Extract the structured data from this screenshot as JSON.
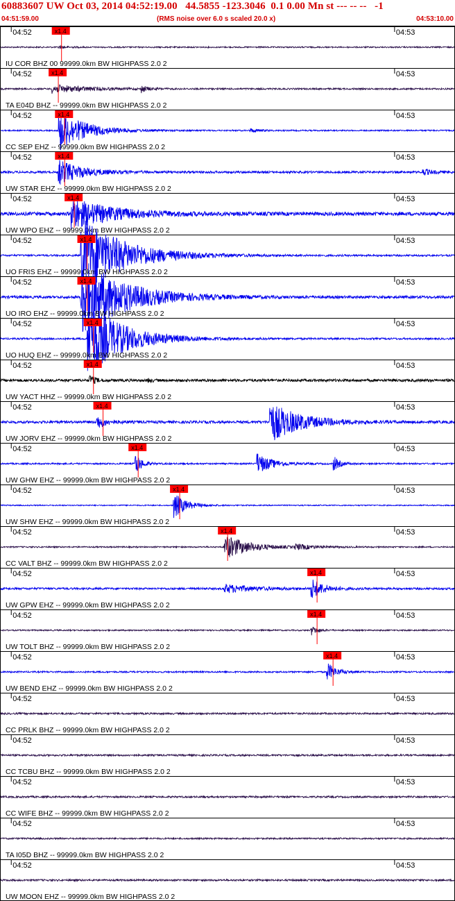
{
  "header": {
    "title": "60883607 UW Oct 03, 2014 04:52:19.00   44.5855 -123.3046  0.1 0.00 Mn st --- -- --   -1",
    "start_time": "04:51:59.00",
    "note": "(RMS noise over 6.0 s scaled 20.0 x)",
    "end_time": "04:53:10.00"
  },
  "colors": {
    "title": "#d40000",
    "trace_blue": "#0000ee",
    "trace_dark": "#2a0f4a",
    "trace_black": "#000000",
    "pick_box": "#ff0000",
    "pick_line": "#ff0000",
    "grid": "#000000"
  },
  "chart_data": {
    "type": "seismogram",
    "x_range_seconds": [
      0,
      71
    ],
    "time_ticks": [
      {
        "label": "04:52",
        "t": 1
      },
      {
        "label": "04:53",
        "t": 61
      }
    ],
    "pick_label": "x1.4",
    "traces": [
      {
        "label": "IU COR BHZ 00 99999.0km BW  HIGHPASS  2.0  2",
        "pick_t": 8.0,
        "color": "dark",
        "noise": 0.6,
        "events": [
          {
            "t": 9,
            "amp": 2,
            "dur": 3
          }
        ]
      },
      {
        "label": "TA E04D BHZ -- 99999.0km BW  HIGHPASS  2.0  2",
        "pick_t": 7.5,
        "color": "dark",
        "noise": 0.7,
        "events": [
          {
            "t": 8,
            "amp": 6,
            "dur": 12
          },
          {
            "t": 22,
            "amp": 5,
            "dur": 2
          }
        ]
      },
      {
        "label": "CC SEP EHZ -- 99999.0km BW  HIGHPASS  2.0  2",
        "pick_t": 8.5,
        "color": "blue",
        "noise": 0.6,
        "events": [
          {
            "t": 9,
            "amp": 30,
            "dur": 9
          },
          {
            "t": 39,
            "amp": 3,
            "dur": 3
          }
        ]
      },
      {
        "label": "UW STAR EHZ -- 99999.0km BW  HIGHPASS  2.0  2",
        "pick_t": 8.5,
        "color": "blue",
        "noise": 1.0,
        "events": [
          {
            "t": 9,
            "amp": 18,
            "dur": 8
          },
          {
            "t": 66,
            "amp": 4,
            "dur": 4
          }
        ]
      },
      {
        "label": "UW WPO EHZ -- 99999.0km BW  HIGHPASS  2.0  2",
        "pick_t": 10.0,
        "color": "blue",
        "noise": 1.6,
        "events": [
          {
            "t": 11,
            "amp": 22,
            "dur": 14
          }
        ]
      },
      {
        "label": "UO FRIS EHZ -- 99999.0km BW  HIGHPASS  2.0  2",
        "pick_t": 12.0,
        "color": "blue",
        "noise": 0.8,
        "events": [
          {
            "t": 12.5,
            "amp": 60,
            "dur": 14
          }
        ]
      },
      {
        "label": "UO IRO EHZ -- 99999.0km BW  HIGHPASS  2.0  2",
        "pick_t": 12.0,
        "color": "blue",
        "noise": 1.2,
        "events": [
          {
            "t": 12.5,
            "amp": 60,
            "dur": 14
          }
        ]
      },
      {
        "label": "UO HUQ EHZ -- 99999.0km BW  HIGHPASS  2.0  2",
        "pick_t": 13.0,
        "color": "blue",
        "noise": 0.8,
        "events": [
          {
            "t": 13.5,
            "amp": 55,
            "dur": 12
          }
        ]
      },
      {
        "label": "UW YACT HHZ -- 99999.0km BW  HIGHPASS  2.0  2",
        "pick_t": 13.0,
        "color": "black",
        "noise": 1.2,
        "events": [
          {
            "t": 13.8,
            "amp": 8,
            "dur": 2
          },
          {
            "t": 23,
            "amp": 4,
            "dur": 1
          }
        ]
      },
      {
        "label": "UW JORV EHZ -- 99999.0km BW  HIGHPASS  2.0  2",
        "pick_t": 14.5,
        "color": "blue",
        "noise": 1.2,
        "events": [
          {
            "t": 15,
            "amp": 10,
            "dur": 3
          },
          {
            "t": 42,
            "amp": 30,
            "dur": 10
          }
        ]
      },
      {
        "label": "UW GHW EHZ -- 99999.0km BW  HIGHPASS  2.0  2",
        "pick_t": 20.0,
        "color": "blue",
        "noise": 0.7,
        "events": [
          {
            "t": 21,
            "amp": 18,
            "dur": 2
          },
          {
            "t": 40,
            "amp": 16,
            "dur": 5
          },
          {
            "t": 52,
            "amp": 12,
            "dur": 2
          }
        ]
      },
      {
        "label": "UW SHW EHZ -- 99999.0km BW  HIGHPASS  2.0  2",
        "pick_t": 26.5,
        "color": "blue",
        "noise": 0.5,
        "events": [
          {
            "t": 27,
            "amp": 20,
            "dur": 4
          }
        ]
      },
      {
        "label": "CC VALT BHZ -- 99999.0km BW  HIGHPASS  2.0  2",
        "pick_t": 34.0,
        "color": "dark",
        "noise": 0.6,
        "events": [
          {
            "t": 35,
            "amp": 18,
            "dur": 8
          },
          {
            "t": 46,
            "amp": 4,
            "dur": 6
          }
        ]
      },
      {
        "label": "UW GPW EHZ -- 99999.0km BW  HIGHPASS  2.0  2",
        "pick_t": 48.0,
        "color": "blue",
        "noise": 0.9,
        "events": [
          {
            "t": 35,
            "amp": 6,
            "dur": 10
          },
          {
            "t": 48.5,
            "amp": 16,
            "dur": 4
          }
        ]
      },
      {
        "label": "UW TOLT BHZ -- 99999.0km BW  HIGHPASS  2.0  2",
        "pick_t": 48.0,
        "color": "dark",
        "noise": 0.6,
        "events": [
          {
            "t": 48.5,
            "amp": 8,
            "dur": 2
          }
        ]
      },
      {
        "label": "UW BEND EHZ -- 99999.0km BW  HIGHPASS  2.0  2",
        "pick_t": 50.5,
        "color": "blue",
        "noise": 0.7,
        "events": [
          {
            "t": 51,
            "amp": 14,
            "dur": 3
          }
        ]
      },
      {
        "label": "CC PRLK BHZ -- 99999.0km BW  HIGHPASS  2.0  2",
        "pick_t": null,
        "color": "dark",
        "noise": 0.8,
        "events": []
      },
      {
        "label": "CC TCBU BHZ -- 99999.0km BW  HIGHPASS  2.0  2",
        "pick_t": null,
        "color": "dark",
        "noise": 0.8,
        "events": []
      },
      {
        "label": "CC WIFE BHZ -- 99999.0km BW  HIGHPASS  2.0  2",
        "pick_t": null,
        "color": "dark",
        "noise": 0.8,
        "events": []
      },
      {
        "label": "TA I05D BHZ -- 99999.0km BW  HIGHPASS  2.0  2",
        "pick_t": null,
        "color": "dark",
        "noise": 0.7,
        "events": []
      },
      {
        "label": "UW MOON EHZ -- 99999.0km BW  HIGHPASS  2.0  2",
        "pick_t": null,
        "color": "dark",
        "noise": 0.8,
        "events": []
      }
    ]
  }
}
